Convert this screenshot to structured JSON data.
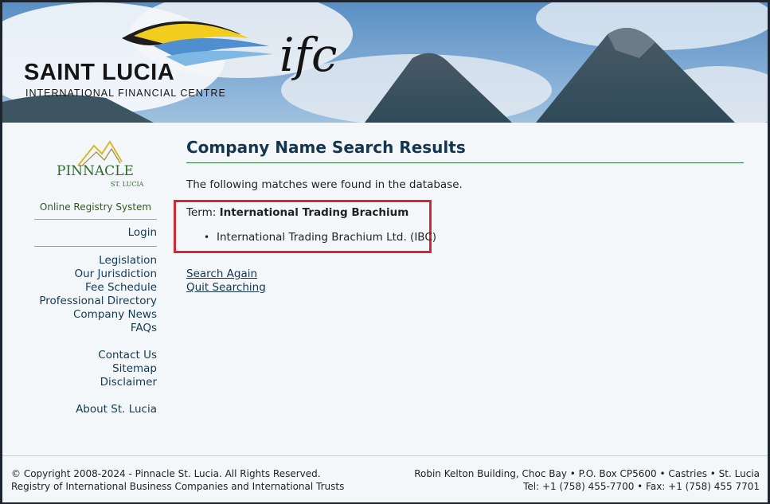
{
  "banner": {
    "title_main": "SAINT LUCIA",
    "title_sub": "INTERNATIONAL FINANCIAL CENTRE",
    "ifc_mark": "ifc"
  },
  "sidebar": {
    "logo_text": "PINNACLE",
    "logo_subtext": "ST. LUCIA",
    "system_label": "Online Registry System",
    "login": "Login",
    "nav_group1": [
      "Legislation",
      "Our Jurisdiction",
      "Fee Schedule",
      "Professional Directory",
      "Company News",
      "FAQs"
    ],
    "nav_group2": [
      "Contact Us",
      "Sitemap",
      "Disclaimer"
    ],
    "nav_group3": [
      "About St. Lucia"
    ]
  },
  "main": {
    "heading": "Company Name Search Results",
    "intro": "The following matches were found in the database.",
    "term_label": "Term:",
    "term_value": "International Trading Brachium",
    "results": [
      "International Trading Brachium Ltd. (IBC)"
    ],
    "search_again": "Search Again",
    "quit_searching": "Quit Searching"
  },
  "footer": {
    "copyright": "© Copyright 2008-2024 - Pinnacle St. Lucia. All Rights Reserved.",
    "registry": "Registry of International Business Companies and International Trusts",
    "address": "Robin Kelton Building, Choc Bay • P.O. Box CP5600 • Castries • St. Lucia",
    "contact": "Tel: +1 (758) 455-7700 • Fax: +1 (758) 455 7701"
  },
  "colors": {
    "heading": "#14364e",
    "highlight": "#d02a34",
    "rule": "#2b7a3a"
  }
}
